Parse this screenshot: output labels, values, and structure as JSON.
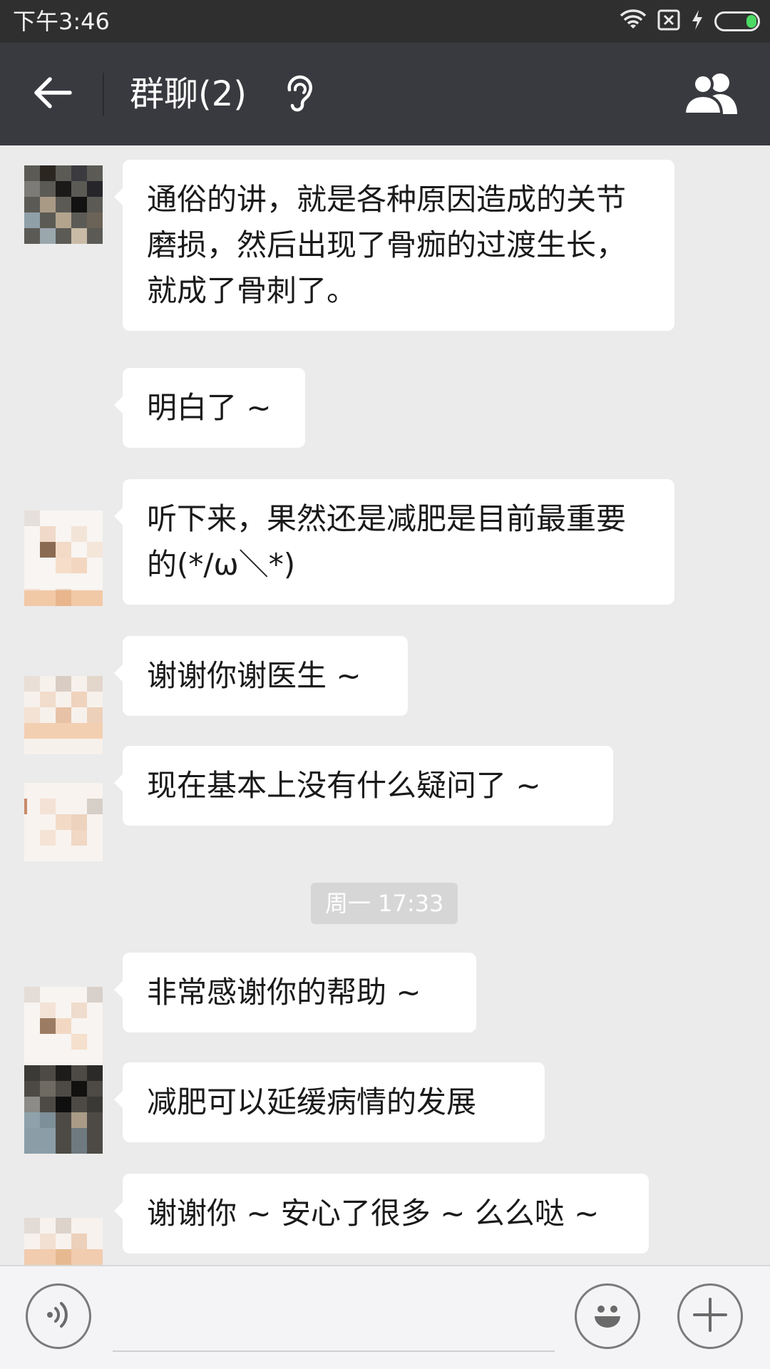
{
  "status_bar": {
    "time": "下午3:46",
    "icons": [
      "wifi-icon",
      "no-sim-icon",
      "charging-icon",
      "battery-icon"
    ],
    "battery_level": 0.25,
    "battery_color": "#4cd964"
  },
  "header": {
    "title": "群聊(2)",
    "back_icon": "back-arrow-icon",
    "mode_icon": "earpiece-icon",
    "members_icon": "group-members-icon",
    "background": "#393a3f"
  },
  "messages": [
    {
      "type": "text",
      "text": "通俗的讲，就是各种原因造成的关节磨损，然后出现了骨痂的过渡生长，就成了骨刺了。"
    },
    {
      "type": "text",
      "text": "明白了 ~"
    },
    {
      "type": "text",
      "text": "听下来，果然还是减肥是目前最重要的(*/ω＼*)"
    },
    {
      "type": "text",
      "text": "谢谢你谢医生 ~"
    },
    {
      "type": "text",
      "text": "现在基本上没有什么疑问了 ~"
    },
    {
      "type": "time",
      "text": "周一 17:33"
    },
    {
      "type": "text",
      "text": "非常感谢你的帮助 ~"
    },
    {
      "type": "text",
      "text": "减肥可以延缓病情的发展"
    },
    {
      "type": "text",
      "text": "谢谢你 ~ 安心了很多 ~ 么么哒 ~"
    }
  ],
  "input_bar": {
    "voice_icon": "voice-input-icon",
    "emoji_icon": "emoji-icon",
    "plus_icon": "plus-icon",
    "message_value": ""
  }
}
